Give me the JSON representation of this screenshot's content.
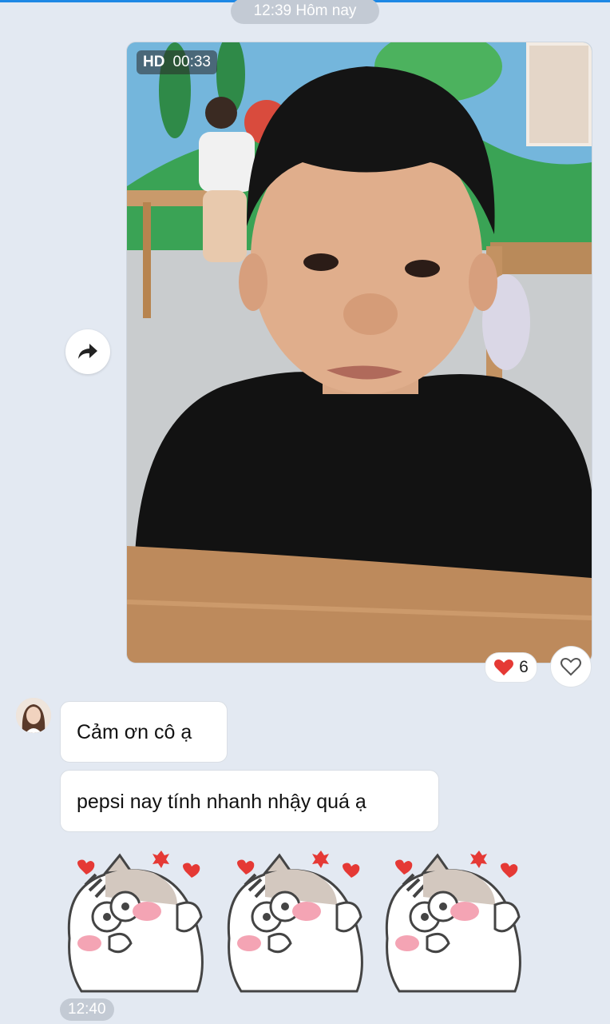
{
  "chat": {
    "date_separator": "12:39 Hôm nay",
    "video": {
      "quality_label": "HD",
      "duration": "00:33"
    },
    "reaction": {
      "emoji": "heart",
      "count": "6"
    },
    "messages": [
      {
        "text": "Cảm ơn cô ạ"
      },
      {
        "text": "pepsi nay tính nhanh nhậy quá ạ"
      }
    ],
    "stickers_count": 3,
    "last_time": "12:40"
  },
  "icons": {
    "forward": "forward-arrow-icon",
    "like": "heart-outline-icon",
    "reaction": "red-heart-icon"
  },
  "colors": {
    "background": "#e3e9f2",
    "accent": "#1e88e5",
    "reaction_heart": "#e53935"
  }
}
